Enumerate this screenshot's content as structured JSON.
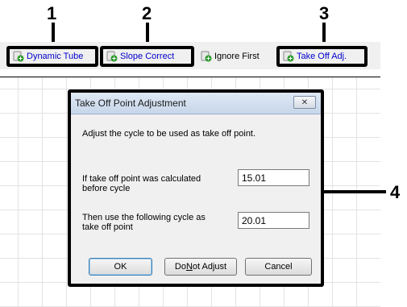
{
  "callouts": [
    "1",
    "2",
    "3",
    "4"
  ],
  "toolbar": {
    "buttons": [
      {
        "label": "Dynamic Tube",
        "icon": "tube-add-icon"
      },
      {
        "label": "Slope Correct",
        "icon": "tube-add-icon"
      },
      {
        "label": "Ignore First",
        "icon": "tube-add-icon"
      },
      {
        "label": "Take Off Adj.",
        "icon": "tube-add-icon"
      }
    ],
    "colors": {
      "link": "#0000cc",
      "icon_green": "#2e9a2e"
    }
  },
  "dialog": {
    "title": "Take Off Point Adjustment",
    "close_glyph": "✕",
    "message": "Adjust the cycle to be used as take off point.",
    "field1_label": "If take off point was calculated before cycle",
    "field1_value": "15.01",
    "field2_label": "Then use the following cycle as take off point",
    "field2_value": "20.01",
    "buttons": {
      "ok": "OK",
      "no_adjust_pre": "Do ",
      "no_adjust_u": "N",
      "no_adjust_post": "ot Adjust",
      "cancel": "Cancel"
    }
  }
}
